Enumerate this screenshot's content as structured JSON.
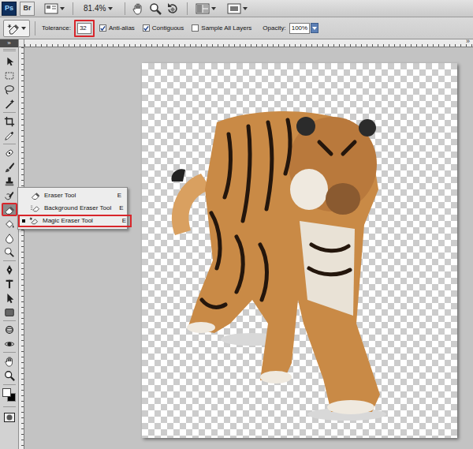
{
  "app_bar": {
    "logo": "Ps",
    "bridge": "Br",
    "zoom": "81.4%"
  },
  "options_bar": {
    "tolerance": {
      "label": "Tolerance:",
      "value": "32"
    },
    "checkboxes": [
      {
        "label": "Anti-alias",
        "checked": true
      },
      {
        "label": "Contiguous",
        "checked": true
      },
      {
        "label": "Sample All Layers",
        "checked": false
      }
    ],
    "opacity": {
      "label": "Opacity:",
      "value": "100%"
    }
  },
  "toolbar": {
    "toggle": "»"
  },
  "panel_dock": {
    "toggle": "»"
  },
  "tool_menu": {
    "items": [
      {
        "label": "Eraser Tool",
        "shortcut": "E",
        "selected": false
      },
      {
        "label": "Background Eraser Tool",
        "shortcut": "E",
        "selected": false
      },
      {
        "label": "Magic Eraser Tool",
        "shortcut": "E",
        "selected": true
      }
    ]
  }
}
